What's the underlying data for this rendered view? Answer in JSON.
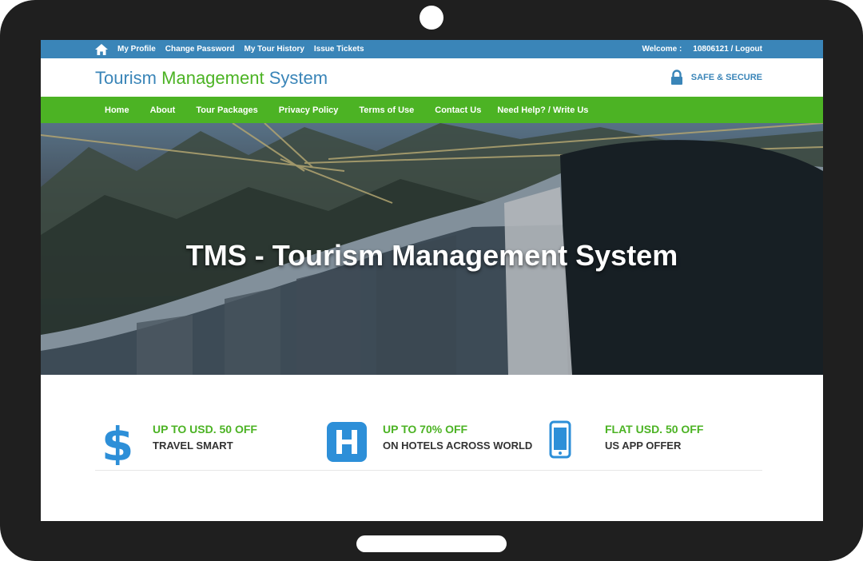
{
  "topbar": {
    "links": [
      "My Profile",
      "Change Password",
      "My Tour History",
      "Issue Tickets"
    ],
    "welcome_label": "Welcome :",
    "user_logout": "10806121 / Logout"
  },
  "header": {
    "logo_part1": "Tourism",
    "logo_part2": "Management",
    "logo_part3": "System",
    "secure_label": "SAFE & SECURE"
  },
  "nav": {
    "items": [
      "Home",
      "About",
      "Tour Packages",
      "Privacy Policy",
      "Terms of Use",
      "Contact Us",
      "Need Help? / Write Us"
    ]
  },
  "hero": {
    "title": "TMS - Tourism Management System"
  },
  "offers": [
    {
      "icon": "dollar-icon",
      "title": "UP TO USD. 50 OFF",
      "subtitle": "TRAVEL SMART"
    },
    {
      "icon": "hotel-icon",
      "title": "UP TO 70% OFF",
      "subtitle": "ON HOTELS ACROSS WORLD"
    },
    {
      "icon": "mobile-icon",
      "title": "FLAT USD. 50 OFF",
      "subtitle": "US APP OFFER"
    }
  ],
  "colors": {
    "brand_blue": "#3a85b8",
    "brand_green": "#4cb324",
    "device_frame": "#1f1f1f"
  }
}
